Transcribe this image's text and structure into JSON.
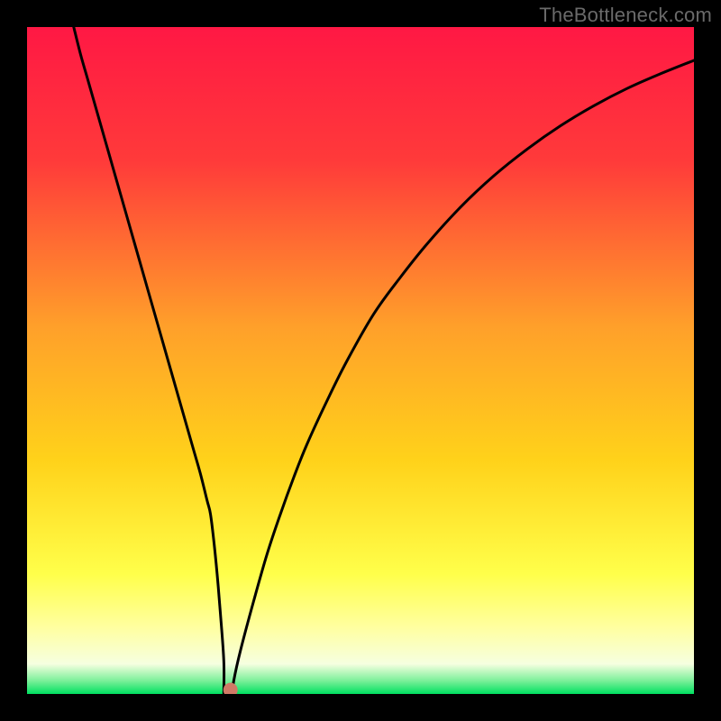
{
  "watermark": "TheBottleneck.com",
  "chart_data": {
    "type": "line",
    "title": "",
    "xlabel": "",
    "ylabel": "",
    "xlim": [
      0,
      100
    ],
    "ylim": [
      0,
      100
    ],
    "gradient_stops": [
      {
        "offset": 0,
        "color": "#ff1844"
      },
      {
        "offset": 0.2,
        "color": "#ff3a3a"
      },
      {
        "offset": 0.45,
        "color": "#ffa02a"
      },
      {
        "offset": 0.65,
        "color": "#ffd21a"
      },
      {
        "offset": 0.82,
        "color": "#ffff4a"
      },
      {
        "offset": 0.9,
        "color": "#ffffa0"
      },
      {
        "offset": 0.955,
        "color": "#f6ffe0"
      },
      {
        "offset": 0.98,
        "color": "#7cf09a"
      },
      {
        "offset": 1.0,
        "color": "#00e060"
      }
    ],
    "series": [
      {
        "name": "curve",
        "x": [
          7,
          8,
          9,
          10,
          12,
          14,
          16,
          18,
          20,
          22,
          24,
          25,
          26,
          27,
          27.5,
          28,
          28.5,
          29,
          29.5,
          29.5,
          30.8,
          31,
          32,
          34,
          36,
          38,
          40,
          42,
          45,
          48,
          52,
          56,
          60,
          65,
          70,
          75,
          80,
          85,
          90,
          95,
          100
        ],
        "y": [
          100,
          96,
          92.5,
          89,
          82,
          75,
          68,
          61,
          54,
          47,
          40,
          36.5,
          33,
          29,
          27,
          23,
          18,
          12,
          5,
          0,
          0,
          2,
          6.5,
          14,
          21,
          27,
          32.5,
          37.5,
          44,
          50,
          57,
          62.5,
          67.5,
          73,
          77.7,
          81.7,
          85.2,
          88.2,
          90.8,
          93,
          95
        ]
      }
    ],
    "flat_segment": {
      "x0": 29.5,
      "x1": 30.8,
      "y": 0
    },
    "marker": {
      "x": 30.5,
      "y": 0.6,
      "r": 8,
      "color": "#cf7a66"
    }
  }
}
